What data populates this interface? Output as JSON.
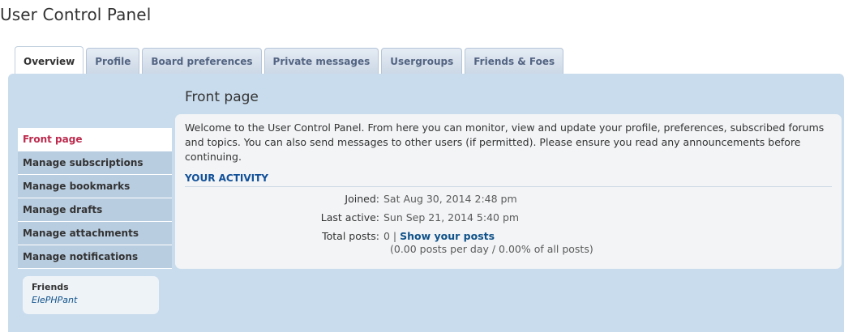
{
  "page": {
    "title": "User Control Panel"
  },
  "tabs": [
    {
      "label": "Overview",
      "active": true
    },
    {
      "label": "Profile"
    },
    {
      "label": "Board preferences"
    },
    {
      "label": "Private messages"
    },
    {
      "label": "Usergroups"
    },
    {
      "label": "Friends & Foes"
    }
  ],
  "section": {
    "title": "Front page"
  },
  "sidebar": {
    "items": [
      {
        "label": "Front page",
        "active": true
      },
      {
        "label": "Manage subscriptions"
      },
      {
        "label": "Manage bookmarks"
      },
      {
        "label": "Manage drafts"
      },
      {
        "label": "Manage attachments"
      },
      {
        "label": "Manage notifications"
      }
    ]
  },
  "friends": {
    "heading": "Friends",
    "names": [
      "ElePHPant"
    ]
  },
  "content": {
    "welcome": "Welcome to the User Control Panel. From here you can monitor, view and update your profile, preferences, subscribed forums and topics. You can also send messages to other users (if permitted). Please ensure you read any announcements before continuing.",
    "activity_heading": "YOUR ACTIVITY",
    "joined_label": "Joined:",
    "joined_value": "Sat Aug 30, 2014 2:48 pm",
    "last_active_label": "Last active:",
    "last_active_value": "Sun Sep 21, 2014 5:40 pm",
    "total_posts_label": "Total posts:",
    "total_posts_value": "0 | ",
    "show_posts_link": "Show your posts",
    "posts_stats": "(0.00 posts per day / 0.00% of all posts)"
  },
  "colors": {
    "panel_bg": "#c9dced",
    "nav_active": "#bc2a4d",
    "link": "#105289",
    "heading_blue": "#115098"
  }
}
